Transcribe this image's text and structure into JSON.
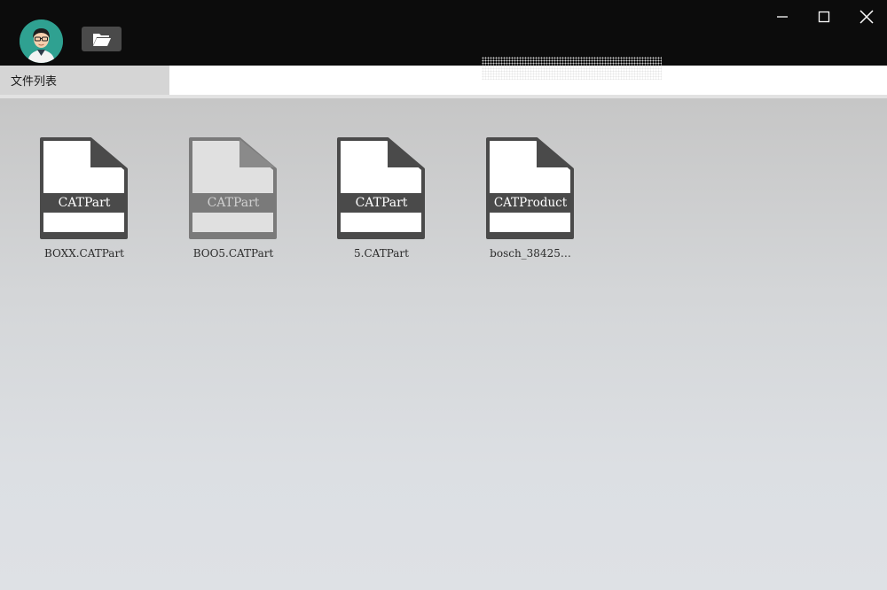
{
  "window": {
    "minimize_icon": "minimize-icon",
    "maximize_icon": "maximize-icon",
    "close_icon": "close-icon"
  },
  "header": {
    "avatar_icon": "user-avatar",
    "open_folder_icon": "folder-open-icon"
  },
  "tabs": [
    {
      "label": "文件列表",
      "active": true
    }
  ],
  "files": [
    {
      "type": "CATPart",
      "name": "BOXX.CATPart",
      "selected": false
    },
    {
      "type": "CATPart",
      "name": "BOO5.CATPart",
      "selected": true
    },
    {
      "type": "CATPart",
      "name": "5.CATPart",
      "selected": false
    },
    {
      "type": "CATProduct",
      "name": "bosch_38425…",
      "selected": false
    }
  ],
  "colors": {
    "titlebar": "#0c0c0c",
    "file_icon_dark": "#4a4a4a",
    "file_icon_selected": "#7a7a7a"
  }
}
